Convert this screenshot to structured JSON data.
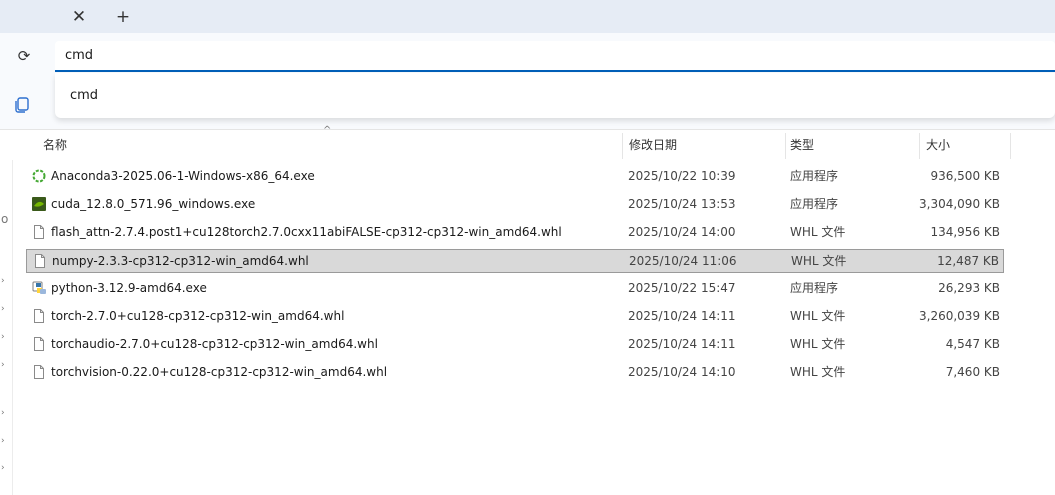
{
  "tabbar": {
    "close_glyph": "✕",
    "add_glyph": "+"
  },
  "addressbar": {
    "refresh_glyph": "⟳",
    "value": "cmd"
  },
  "suggestions": [
    {
      "label": "cmd"
    }
  ],
  "columns": {
    "name": "名称",
    "date": "修改日期",
    "type": "类型",
    "size": "大小"
  },
  "files": [
    {
      "name": "Anaconda3-2025.06-1-Windows-x86_64.exe",
      "date": "2025/10/22 10:39",
      "type": "应用程序",
      "size": "936,500 KB",
      "icon": "anaconda-icon"
    },
    {
      "name": "cuda_12.8.0_571.96_windows.exe",
      "date": "2025/10/24 13:53",
      "type": "应用程序",
      "size": "3,304,090 KB",
      "icon": "nvidia-icon"
    },
    {
      "name": "flash_attn-2.7.4.post1+cu128torch2.7.0cxx11abiFALSE-cp312-cp312-win_amd64.whl",
      "date": "2025/10/24 14:00",
      "type": "WHL 文件",
      "size": "134,956 KB",
      "icon": "file-icon"
    },
    {
      "name": "numpy-2.3.3-cp312-cp312-win_amd64.whl",
      "date": "2025/10/24 11:06",
      "type": "WHL 文件",
      "size": "12,487 KB",
      "icon": "file-icon",
      "selected": true
    },
    {
      "name": "python-3.12.9-amd64.exe",
      "date": "2025/10/22 15:47",
      "type": "应用程序",
      "size": "26,293 KB",
      "icon": "python-installer-icon"
    },
    {
      "name": "torch-2.7.0+cu128-cp312-cp312-win_amd64.whl",
      "date": "2025/10/24 14:11",
      "type": "WHL 文件",
      "size": "3,260,039 KB",
      "icon": "file-icon"
    },
    {
      "name": "torchaudio-2.7.0+cu128-cp312-cp312-win_amd64.whl",
      "date": "2025/10/24 14:11",
      "type": "WHL 文件",
      "size": "4,547 KB",
      "icon": "file-icon"
    },
    {
      "name": "torchvision-0.22.0+cu128-cp312-cp312-win_amd64.whl",
      "date": "2025/10/24 14:10",
      "type": "WHL 文件",
      "size": "7,460 KB",
      "icon": "file-icon"
    }
  ],
  "colors": {
    "accent": "#005fb8",
    "selection": "#d9d9d9",
    "tabbar_bg": "#e6ecf5"
  }
}
